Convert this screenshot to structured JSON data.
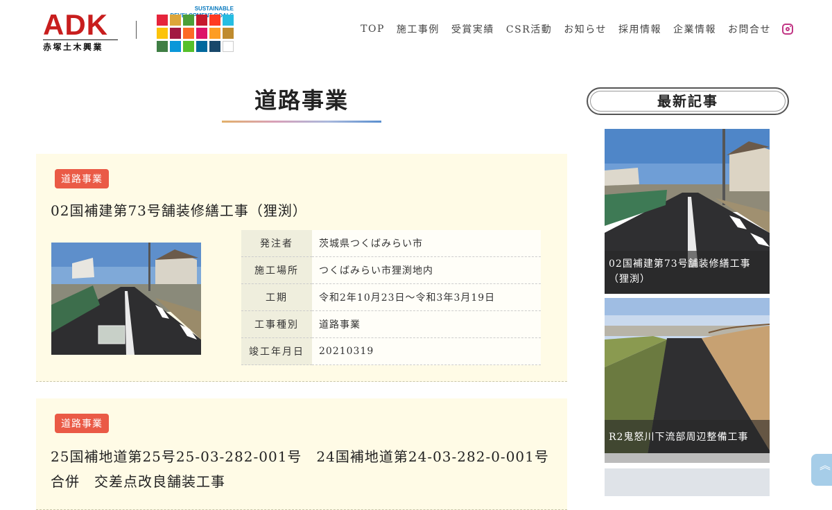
{
  "header": {
    "logo_main": "ADK",
    "logo_sub": "赤塚土木興業",
    "sdgs_label": "SUSTAINABLE DEVELOPMENT GOALS",
    "nav": [
      "TOP",
      "施工事例",
      "受賞実績",
      "CSR活動",
      "お知らせ",
      "採用情報",
      "企業情報",
      "お問合せ"
    ],
    "instagram_icon": "instagram-icon"
  },
  "page": {
    "title": "道路事業"
  },
  "cards": [
    {
      "badge": "道路事業",
      "title": "02国補建第73号舗装修繕工事（狸渕）",
      "details": [
        {
          "key": "発注者",
          "value": "茨城県つくばみらい市"
        },
        {
          "key": "施工場所",
          "value": "つくばみらい市狸渕地内"
        },
        {
          "key": "工期",
          "value": "令和2年10月23日～令和3年3月19日"
        },
        {
          "key": "工事種別",
          "value": "道路事業"
        },
        {
          "key": "竣工年月日",
          "value": "20210319"
        }
      ]
    },
    {
      "badge": "道路事業",
      "title": "25国補地道第25号25-03-282-001号　24国補地道第24-03-282-0-001号合併　交差点改良舗装工事"
    }
  ],
  "sidebar": {
    "heading": "最新記事",
    "posts": [
      {
        "caption": "02国補建第73号舗装修繕工事（狸渕）"
      },
      {
        "caption": "R2鬼怒川下流部周辺整備工事"
      },
      {
        "caption": ""
      }
    ]
  },
  "scroll_top_icon": "double-chevron-up-icon",
  "colors": {
    "brand_red": "#c81e1e",
    "badge": "#ea5a46",
    "card_bg": "#fffbe6",
    "instagram": "#c13584"
  }
}
